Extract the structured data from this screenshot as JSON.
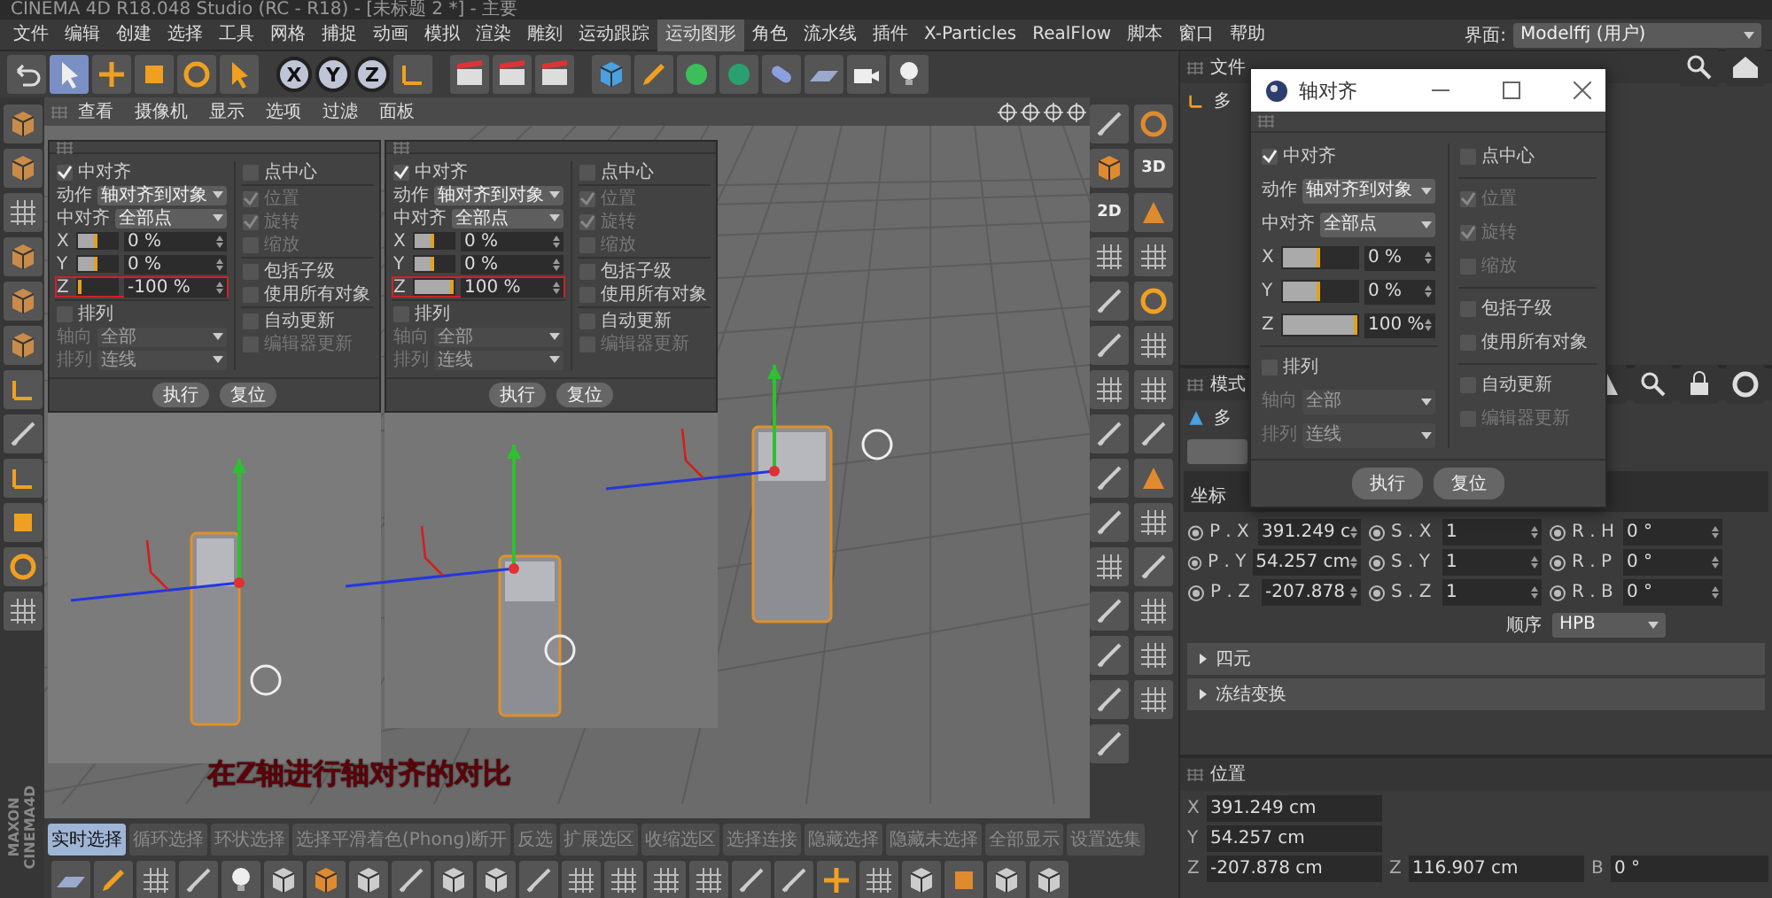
{
  "title_bar": {
    "title": "CINEMA 4D R18.048 Studio (RC - R18) - [未标题 2 *] - 主要"
  },
  "menu": [
    {
      "label": "文件",
      "selected": false
    },
    {
      "label": "编辑",
      "selected": false
    },
    {
      "label": "创建",
      "selected": false
    },
    {
      "label": "选择",
      "selected": false
    },
    {
      "label": "工具",
      "selected": false
    },
    {
      "label": "网格",
      "selected": false
    },
    {
      "label": "捕捉",
      "selected": false
    },
    {
      "label": "动画",
      "selected": false
    },
    {
      "label": "模拟",
      "selected": false
    },
    {
      "label": "渲染",
      "selected": false
    },
    {
      "label": "雕刻",
      "selected": false
    },
    {
      "label": "运动跟踪",
      "selected": false
    },
    {
      "label": "运动图形",
      "selected": true
    },
    {
      "label": "角色",
      "selected": false
    },
    {
      "label": "流水线",
      "selected": false
    },
    {
      "label": "插件",
      "selected": false
    },
    {
      "label": "X-Particles",
      "selected": false
    },
    {
      "label": "RealFlow",
      "selected": false
    },
    {
      "label": "脚本",
      "selected": false
    },
    {
      "label": "窗口",
      "selected": false
    },
    {
      "label": "帮助",
      "selected": false
    }
  ],
  "layout_selector": {
    "label": "界面:",
    "value": "Modelffj (用户)"
  },
  "toolbar": {
    "axis_buttons": [
      "X",
      "Y",
      "Z"
    ]
  },
  "right_tools": {
    "labels": [
      "3D",
      "2D"
    ]
  },
  "viewport": {
    "menu": [
      "查看",
      "摄像机",
      "显示",
      "选项",
      "过滤",
      "面板"
    ],
    "caption": "在Z轴进行轴对齐的对比",
    "insets": [
      {
        "enable": {
          "label": "中对齐",
          "checked": true
        },
        "fields": [
          {
            "label": "动作",
            "value": "轴对齐到对象"
          },
          {
            "label": "中对齐",
            "value": "全部点"
          }
        ],
        "axes": [
          {
            "label": "X",
            "level": 0.5,
            "value": "0 %",
            "highlighted": false
          },
          {
            "label": "Y",
            "level": 0.5,
            "value": "0 %",
            "highlighted": false
          },
          {
            "label": "Z",
            "level": 0,
            "value": "-100 %",
            "highlighted": true
          }
        ],
        "sort": {
          "label": "排列",
          "checked": false
        },
        "sort_fields": [
          {
            "label": "轴向",
            "value": "全部",
            "disabled": true
          },
          {
            "label": "排列",
            "value": "连线",
            "disabled": true
          }
        ],
        "options": [
          {
            "items": [
              {
                "label": "点中心",
                "checked": false,
                "disabled": false
              }
            ]
          },
          {
            "items": [
              {
                "label": "位置",
                "checked": true,
                "disabled": true
              },
              {
                "label": "旋转",
                "checked": true,
                "disabled": true
              },
              {
                "label": "缩放",
                "checked": false,
                "disabled": true
              }
            ]
          },
          {
            "items": [
              {
                "label": "包括子级",
                "checked": false,
                "disabled": false
              },
              {
                "label": "使用所有对象",
                "checked": false,
                "disabled": false
              }
            ]
          },
          {
            "items": [
              {
                "label": "自动更新",
                "checked": false,
                "disabled": false
              },
              {
                "label": "编辑器更新",
                "checked": false,
                "disabled": true
              }
            ]
          }
        ],
        "buttons": [
          "执行",
          "复位"
        ]
      },
      {
        "enable": {
          "label": "中对齐",
          "checked": true
        },
        "fields": [
          {
            "label": "动作",
            "value": "轴对齐到对象"
          },
          {
            "label": "中对齐",
            "value": "全部点"
          }
        ],
        "axes": [
          {
            "label": "X",
            "level": 0.5,
            "value": "0 %",
            "highlighted": false
          },
          {
            "label": "Y",
            "level": 0.5,
            "value": "0 %",
            "highlighted": false
          },
          {
            "label": "Z",
            "level": 1,
            "value": "100 %",
            "highlighted": true
          }
        ],
        "sort": {
          "label": "排列",
          "checked": false
        },
        "sort_fields": [
          {
            "label": "轴向",
            "value": "全部",
            "disabled": true
          },
          {
            "label": "排列",
            "value": "连线",
            "disabled": true
          }
        ],
        "options": [
          {
            "items": [
              {
                "label": "点中心",
                "checked": false,
                "disabled": false
              }
            ]
          },
          {
            "items": [
              {
                "label": "位置",
                "checked": true,
                "disabled": true
              },
              {
                "label": "旋转",
                "checked": true,
                "disabled": true
              },
              {
                "label": "缩放",
                "checked": false,
                "disabled": true
              }
            ]
          },
          {
            "items": [
              {
                "label": "包括子级",
                "checked": false,
                "disabled": false
              },
              {
                "label": "使用所有对象",
                "checked": false,
                "disabled": false
              }
            ]
          },
          {
            "items": [
              {
                "label": "自动更新",
                "checked": false,
                "disabled": false
              },
              {
                "label": "编辑器更新",
                "checked": false,
                "disabled": true
              }
            ]
          }
        ],
        "buttons": [
          "执行",
          "复位"
        ]
      }
    ]
  },
  "dialog": {
    "title": "轴对齐",
    "enable": {
      "label": "中对齐",
      "checked": true
    },
    "fields": [
      {
        "label": "动作",
        "value": "轴对齐到对象"
      },
      {
        "label": "中对齐",
        "value": "全部点"
      }
    ],
    "axes": [
      {
        "label": "X",
        "level": 0.5,
        "value": "0 %",
        "highlighted": false
      },
      {
        "label": "Y",
        "level": 0.5,
        "value": "0 %",
        "highlighted": false
      },
      {
        "label": "Z",
        "level": 1,
        "value": "100 %",
        "highlighted": false
      }
    ],
    "sort": {
      "label": "排列",
      "checked": false
    },
    "sort_fields": [
      {
        "label": "轴向",
        "value": "全部",
        "disabled": true
      },
      {
        "label": "排列",
        "value": "连线",
        "disabled": true
      }
    ],
    "options": [
      {
        "items": [
          {
            "label": "点中心",
            "checked": false,
            "disabled": false
          }
        ]
      },
      {
        "items": [
          {
            "label": "位置",
            "checked": true,
            "disabled": true
          },
          {
            "label": "旋转",
            "checked": true,
            "disabled": true
          },
          {
            "label": "缩放",
            "checked": false,
            "disabled": true
          }
        ]
      },
      {
        "items": [
          {
            "label": "包括子级",
            "checked": false,
            "disabled": false
          },
          {
            "label": "使用所有对象",
            "checked": false,
            "disabled": false
          }
        ]
      },
      {
        "items": [
          {
            "label": "自动更新",
            "checked": false,
            "disabled": false
          },
          {
            "label": "编辑器更新",
            "checked": false,
            "disabled": true
          }
        ]
      }
    ],
    "buttons": [
      "执行",
      "复位"
    ]
  },
  "object_manager": {
    "menu": [
      "文件"
    ],
    "object": "多"
  },
  "attributes": {
    "mode": "模式",
    "object": "多",
    "section": "坐标",
    "rows": [
      {
        "cells": [
          {
            "label": "P . X",
            "value": "391.249 c",
            "keyed": false
          },
          {
            "label": "S . X",
            "value": "1",
            "keyed": false
          },
          {
            "label": "R . H",
            "value": "0 °",
            "keyed": false
          }
        ]
      },
      {
        "cells": [
          {
            "label": "P . Y",
            "value": "54.257 cm",
            "keyed": false
          },
          {
            "label": "S . Y",
            "value": "1",
            "keyed": false
          },
          {
            "label": "R . P",
            "value": "0 °",
            "keyed": false
          }
        ]
      },
      {
        "cells": [
          {
            "label": "P . Z",
            "value": "-207.878",
            "keyed": false
          },
          {
            "label": "S . Z",
            "value": "1",
            "keyed": false
          },
          {
            "label": "R . B",
            "value": "0 °",
            "keyed": false
          }
        ]
      }
    ],
    "order": {
      "label": "顺序",
      "value": "HPB"
    },
    "groups": [
      {
        "label": "四元",
        "expanded": false
      },
      {
        "label": "冻结变换",
        "expanded": false
      }
    ]
  },
  "coordinates": {
    "title": "位置",
    "rows": [
      {
        "cells": [
          {
            "label": "X",
            "value": "391.249 cm"
          }
        ]
      },
      {
        "cells": [
          {
            "label": "Y",
            "value": "54.257 cm"
          }
        ]
      },
      {
        "cells": [
          {
            "label": "Z",
            "value": "-207.878 cm"
          },
          {
            "label": "Z",
            "value": "116.907 cm"
          },
          {
            "label": "B",
            "value": "0 °"
          }
        ]
      }
    ]
  },
  "logo": {
    "lines": [
      "MAXON",
      "CINEMA4D"
    ]
  },
  "selection_modes": [
    {
      "label": "实时选择",
      "selected": true
    },
    {
      "label": "循环选择",
      "selected": false
    },
    {
      "label": "环状选择",
      "selected": false
    },
    {
      "label": "选择平滑着色(Phong)断开",
      "selected": false
    },
    {
      "label": "反选",
      "selected": false
    },
    {
      "label": "扩展选区",
      "selected": false
    },
    {
      "label": "收缩选区",
      "selected": false
    },
    {
      "label": "选择连接",
      "selected": false
    },
    {
      "label": "隐藏选择",
      "selected": false
    },
    {
      "label": "隐藏未选择",
      "selected": false
    },
    {
      "label": "全部显示",
      "selected": false
    },
    {
      "label": "设置选集",
      "selected": false
    }
  ]
}
